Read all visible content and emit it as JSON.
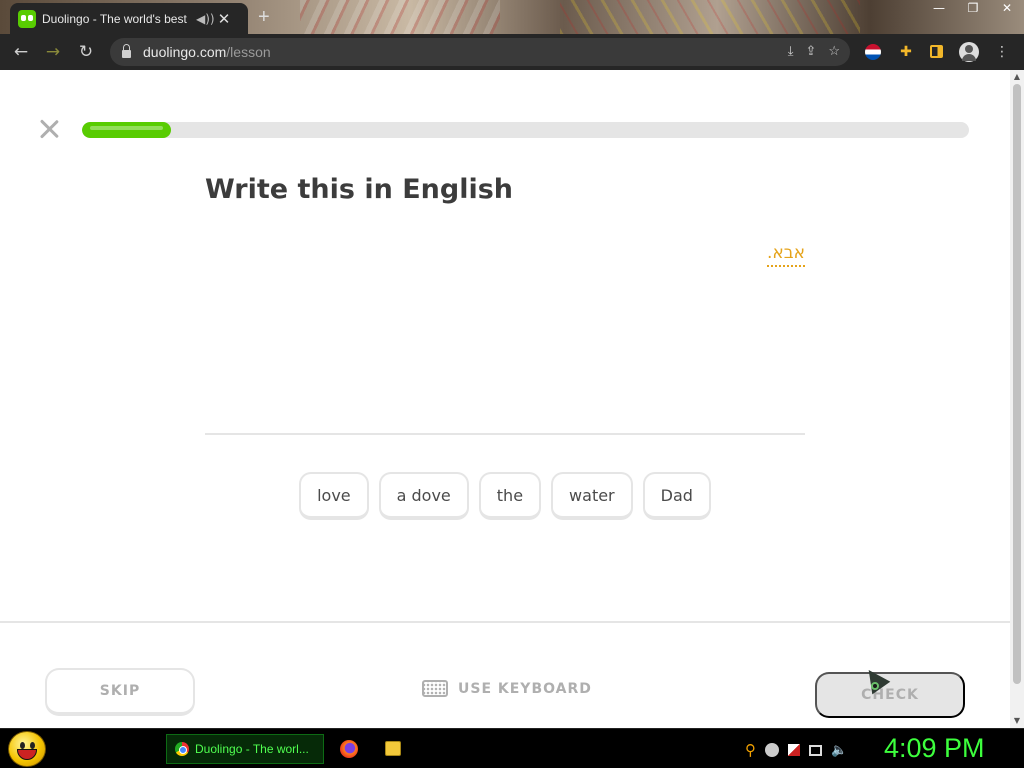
{
  "browser": {
    "tab_title": "Duolingo - The world's best",
    "tab_audio_icon": "speaker-icon",
    "tab_close": "✕",
    "new_tab": "+",
    "window_controls": [
      "—",
      "❐",
      "✕"
    ],
    "url_host": "duolingo.com",
    "url_path": "/lesson"
  },
  "lesson": {
    "progress": 0.1,
    "title": "Write this in English",
    "prompt_word": "אבא.",
    "word_bank": [
      "love",
      "a dove",
      "the",
      "water",
      "Dad"
    ],
    "skip_label": "SKIP",
    "keyboard_label": "USE KEYBOARD",
    "check_label": "CHECK"
  },
  "colors": {
    "accent_green": "#58cc02",
    "prompt_orange": "#e5a31a",
    "disabled_gray": "#afafaf"
  },
  "taskbar": {
    "task_label": "Duolingo - The worl...",
    "clock": "4:09 PM"
  }
}
